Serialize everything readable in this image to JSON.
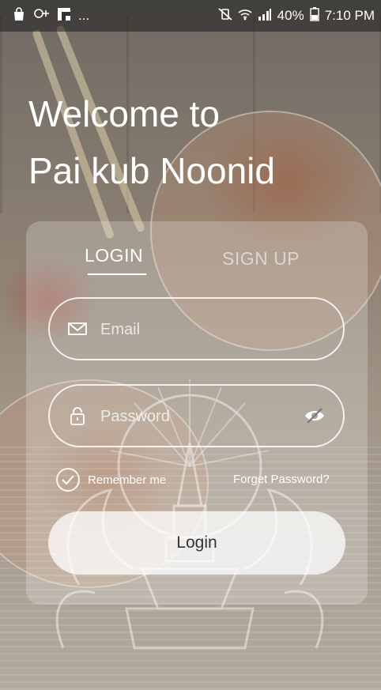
{
  "status_bar": {
    "battery_percent": "40%",
    "time": "7:10 PM",
    "left_icons": [
      "bag-icon",
      "chat-icon",
      "flipboard-icon",
      "more-notifications-icon"
    ],
    "more_indicator": "...",
    "right_icons": [
      "mute-vibrate-icon",
      "wifi-icon",
      "signal-icon",
      "battery-icon"
    ]
  },
  "welcome": {
    "line1": "Welcome to",
    "line2": "Pai kub Noonid"
  },
  "tabs": {
    "login_label": "LOGIN",
    "signup_label": "SIGN UP",
    "active": "login"
  },
  "form": {
    "email_placeholder": "Email",
    "email_value": "",
    "password_placeholder": "Password",
    "password_value": "",
    "remember_label": "Remember me",
    "remember_checked": true,
    "forgot_label": "Forget Password?",
    "login_button": "Login"
  }
}
